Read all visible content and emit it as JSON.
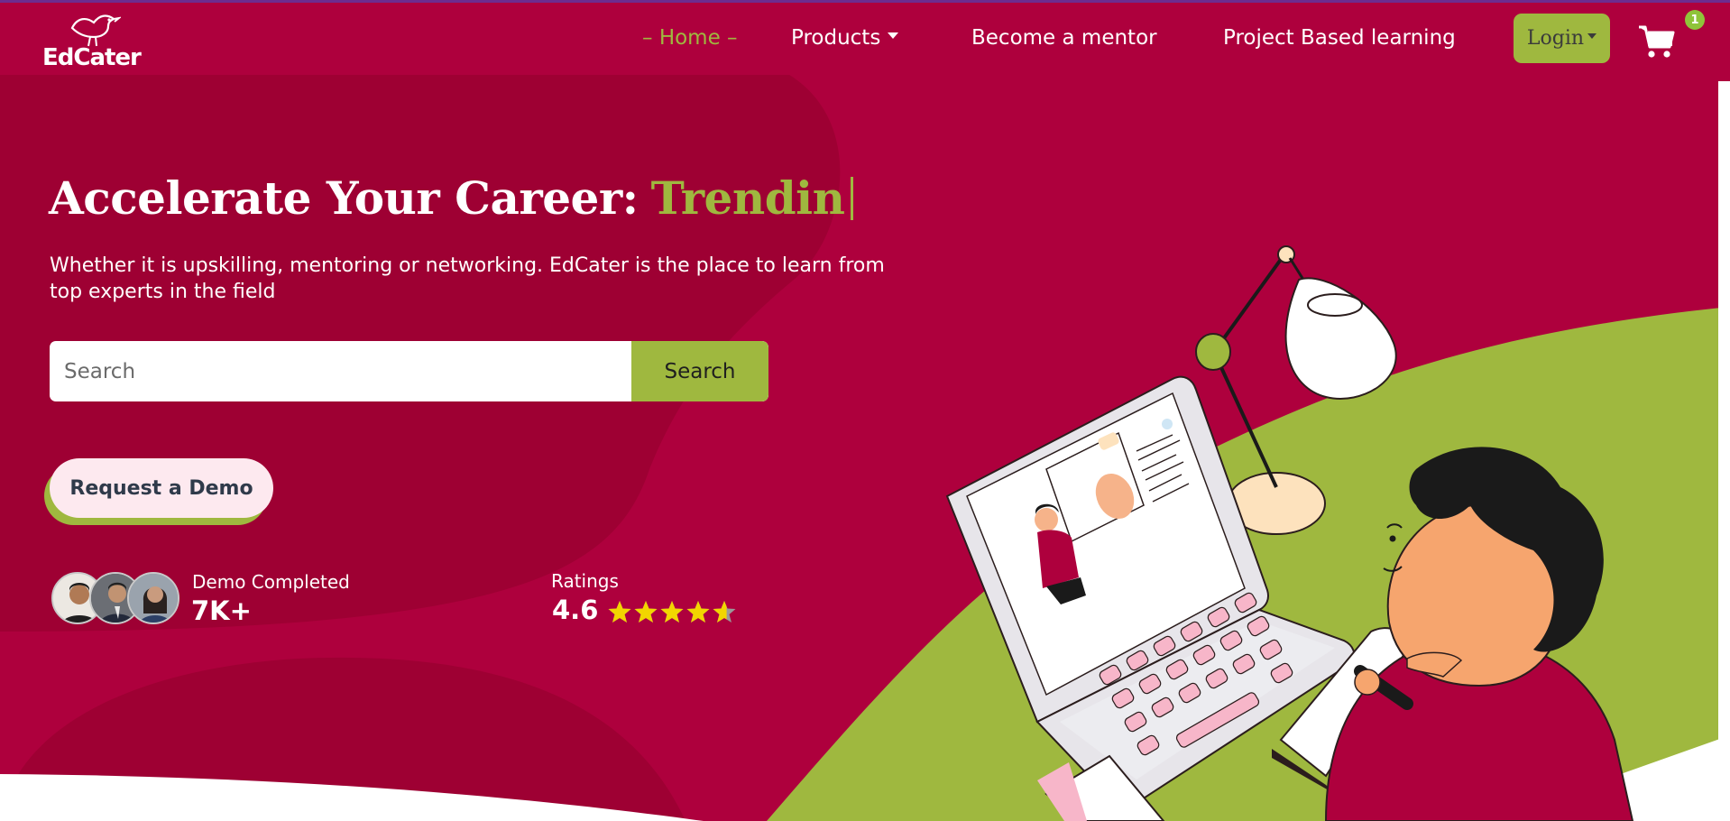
{
  "brand": {
    "name": "EdCater"
  },
  "nav": {
    "home": "Home",
    "products": "Products",
    "become_mentor": "Become a mentor",
    "project_learning": "Project Based learning",
    "login": "Login",
    "cart_count": "1",
    "cart_icon": "shopping-cart-icon"
  },
  "hero": {
    "title_static": "Accelerate Your Career:",
    "title_typed": "Trendin",
    "subtitle": "Whether it is upskilling, mentoring or networking. EdCater is the place to learn from top experts in the field",
    "search_placeholder": "Search",
    "search_button": "Search",
    "demo_button": "Request a Demo"
  },
  "stats": {
    "demo_label": "Demo Completed",
    "demo_value": "7K+",
    "rating_label": "Ratings",
    "rating_value": "4.6",
    "rating_stars": 4.6,
    "rating_max": 5
  },
  "colors": {
    "primary": "#ae003d",
    "accent": "#9fb83f",
    "star": "#f2d600",
    "demo_button_bg": "#fde9ef"
  }
}
